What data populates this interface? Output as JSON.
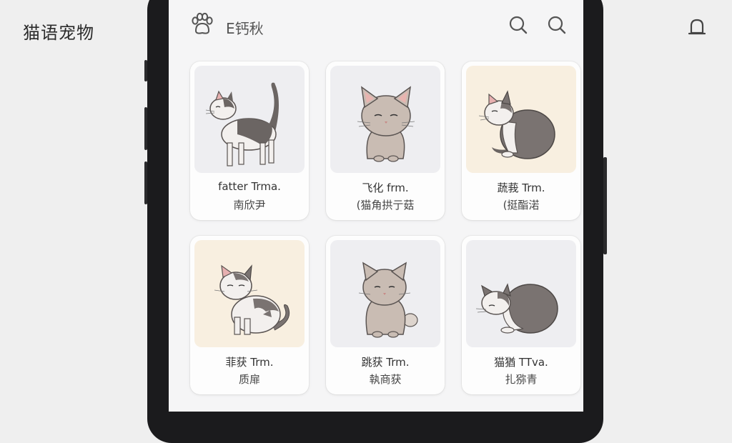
{
  "app": {
    "title": "猫语宠物"
  },
  "header": {
    "title": "E钙秋",
    "icons": [
      "paw-icon",
      "search-icon",
      "search-icon",
      "bell-icon"
    ]
  },
  "colors": {
    "thumb_gray": "#eeeef1",
    "thumb_cream": "#f8efe0",
    "phone": "#1b1b1d"
  },
  "cards": [
    {
      "name": "fatter Trma.",
      "subtitle": "南欣尹",
      "background": "#eeeef1"
    },
    {
      "name": "飞化 frm.",
      "subtitle": "(猫角拱亍菇",
      "background": "#eeeef1"
    },
    {
      "name": "蔬莪 Trm.",
      "subtitle": "(挺酯渃",
      "background": "#f8efe0"
    },
    {
      "name": "菲获 Trm.",
      "subtitle": "质扉",
      "background": "#f8efe0"
    },
    {
      "name": "跳获 Trm.",
      "subtitle": "執商获",
      "background": "#eeeef1"
    },
    {
      "name": "猫猶 TTva.",
      "subtitle": "扎猕青",
      "background": "#eeeef1"
    }
  ]
}
